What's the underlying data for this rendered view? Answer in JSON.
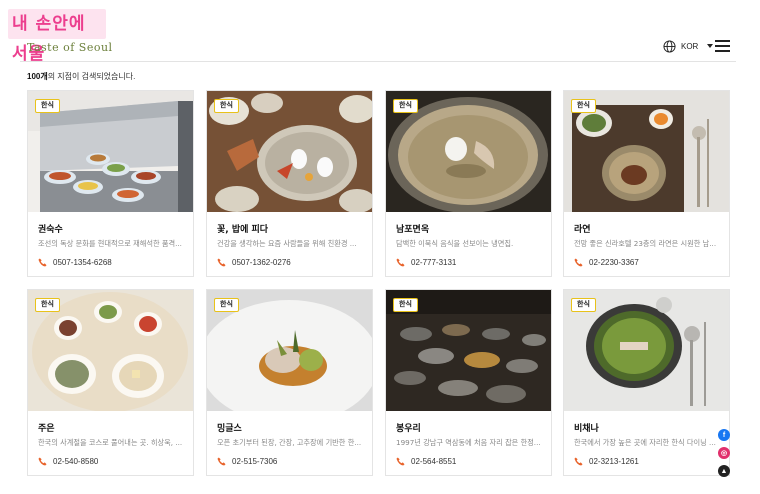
{
  "header": {
    "logo_korean": "내 손안에 서울",
    "logo_english": "Taste of Seoul",
    "language": "KOR"
  },
  "result": {
    "count": "100개",
    "suffix": "의 지점이 검색되었습니다."
  },
  "cards": [
    {
      "tag": "한식",
      "name": "권숙수",
      "desc": "조선의 독상 문화를 현대적으로 재해석한 품격...",
      "phone": "0507-1354-6268"
    },
    {
      "tag": "한식",
      "name": "꽃, 밥에 피다",
      "desc": "건강을 생각하는 요즘 사람들을 위해 친환경 ...",
      "phone": "0507-1362-0276"
    },
    {
      "tag": "한식",
      "name": "남포면옥",
      "desc": "담백한 이북식 음식을 선보이는 냉면집.",
      "phone": "02-777-3131"
    },
    {
      "tag": "한식",
      "name": "라연",
      "desc": "전망 좋은 신라호텔 23층의 라연은 시원한 남...",
      "phone": "02-2230-3367"
    },
    {
      "tag": "한식",
      "name": "주은",
      "desc": "한국의 사계절을 코스로 풀어내는 곳. 히상욱, ...",
      "phone": "02-540-8580"
    },
    {
      "tag": "한식",
      "name": "밍글스",
      "desc": "오픈 초기부터 된장, 간장, 고추장에 기반한 한...",
      "phone": "02-515-7306"
    },
    {
      "tag": "한식",
      "name": "봉우리",
      "desc": "1997년 강남구 역삼동에 처음 자리 잡은 한정...",
      "phone": "02-564-8551"
    },
    {
      "tag": "한식",
      "name": "비채나",
      "desc": "한국에서 가장 높은 곳에 자리한 한식 다이닝 ...",
      "phone": "02-3213-1261"
    }
  ],
  "floating": {
    "facebook": "f",
    "instagram": "◎",
    "top": "▲"
  },
  "colors": {
    "accent_pink": "#ec3e8e",
    "tag_border": "#e8c21a",
    "phone_icon": "#e8632b"
  }
}
